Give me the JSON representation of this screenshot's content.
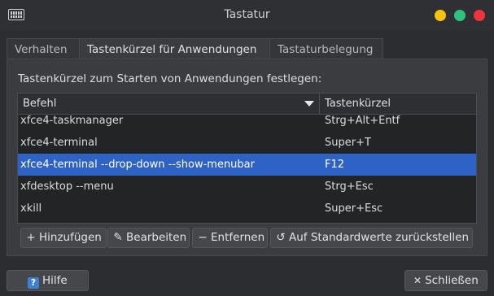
{
  "window": {
    "title": "Tastatur",
    "icon": "keyboard-icon",
    "controls": {
      "minimize_color": "#f5c211",
      "maximize_color": "#2ec27e",
      "close_color": "#ed333b"
    }
  },
  "tabs": [
    {
      "label": "Verhalten",
      "active": false
    },
    {
      "label": "Tastenkürzel für Anwendungen",
      "active": true
    },
    {
      "label": "Tastaturbelegung",
      "active": false
    }
  ],
  "intro_text": "Tastenkürzel zum Starten von Anwendungen festlegen:",
  "table": {
    "columns": [
      "Befehl",
      "Tastenkürzel"
    ],
    "sort_icon": "sort-descending-icon",
    "rows": [
      {
        "command": "xfce4-taskmanager",
        "shortcut": "Strg+Alt+Entf",
        "selected": false
      },
      {
        "command": "xfce4-terminal",
        "shortcut": "Super+T",
        "selected": false
      },
      {
        "command": "xfce4-terminal --drop-down --show-menubar",
        "shortcut": "F12",
        "selected": true
      },
      {
        "command": "xfdesktop --menu",
        "shortcut": "Strg+Esc",
        "selected": false
      },
      {
        "command": "xkill",
        "shortcut": "Super+Esc",
        "selected": false
      }
    ],
    "selection_color": "#2f62c5"
  },
  "actions": {
    "add": {
      "label": "Hinzufügen",
      "icon": "plus-icon"
    },
    "edit": {
      "label": "Bearbeiten",
      "icon": "pencil-icon"
    },
    "remove": {
      "label": "Entfernen",
      "icon": "minus-icon"
    },
    "reset": {
      "label": "Auf Standardwerte zurückstellen",
      "icon": "reset-document-icon"
    }
  },
  "footer": {
    "help": {
      "label": "Hilfe",
      "icon": "help-icon"
    },
    "close": {
      "label": "Schließen",
      "icon": "close-icon"
    }
  }
}
